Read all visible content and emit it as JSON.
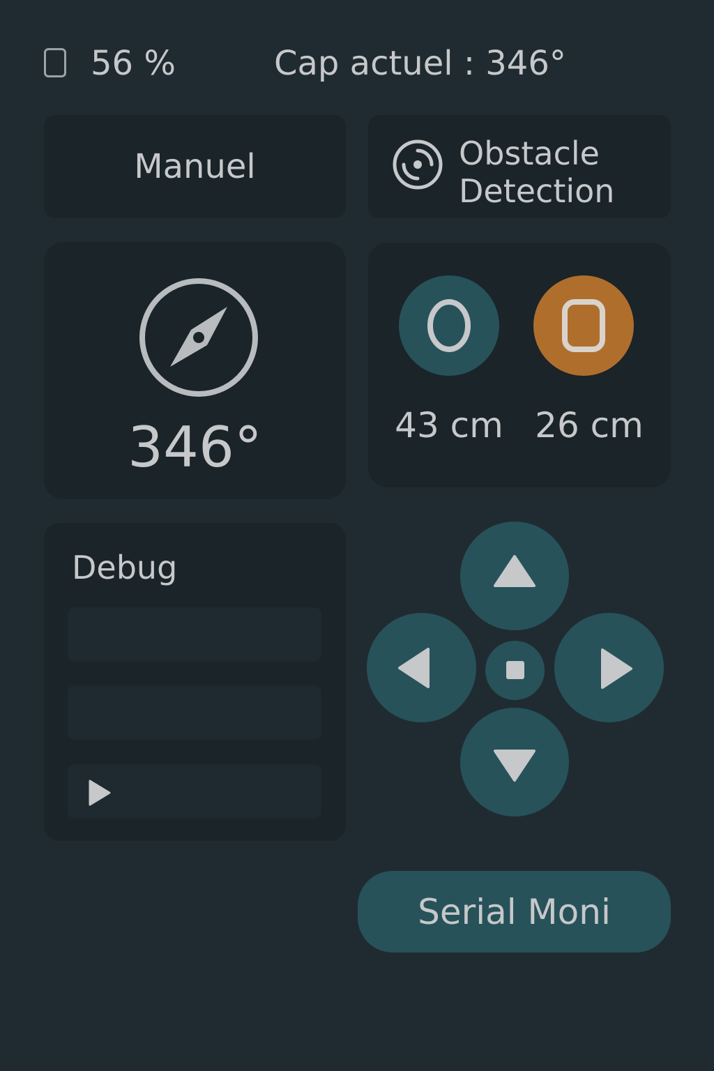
{
  "status_bar": {
    "battery_text": "56 %",
    "heading_text": "Cap actuel :  346°"
  },
  "modes": {
    "manual_label": "Manuel",
    "obstacle_label_line1": "Obstacle",
    "obstacle_label_line2": "Detection"
  },
  "compass": {
    "value": "346°"
  },
  "distances": {
    "left_sensor_glyph": "O",
    "right_sensor_glyph": "0",
    "left_value": "43 cm",
    "right_value": "26 cm",
    "left_color": "#27525a",
    "right_color": "#b06e2d"
  },
  "debug": {
    "title": "Debug",
    "fields": [
      "",
      "",
      ""
    ]
  },
  "controls": {
    "serial_monitor_label": "Serial Moni"
  },
  "icons": {
    "battery": "battery-icon",
    "obstacle": "radar-icon",
    "compass": "compass-icon",
    "play": "play-icon",
    "up": "arrow-up-icon",
    "down": "arrow-down-icon",
    "left": "arrow-left-icon",
    "right": "arrow-right-icon",
    "stop": "stop-icon"
  },
  "colors": {
    "background": "#202b31",
    "card": "#1a2429",
    "accent": "#27525a",
    "warning": "#b06e2d",
    "text": "#c6c8ca"
  }
}
